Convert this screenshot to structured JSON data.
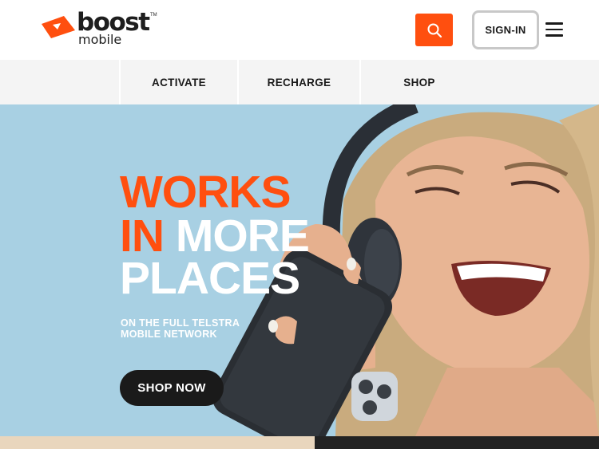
{
  "header": {
    "logo_word": "boost",
    "logo_sub": "mobile",
    "logo_tm": "TM",
    "search_icon": "search-icon",
    "signin_label": "SIGN-IN",
    "menu_icon": "hamburger-menu-icon"
  },
  "nav": {
    "items": [
      {
        "label": "ACTIVATE"
      },
      {
        "label": "RECHARGE"
      },
      {
        "label": "SHOP"
      }
    ]
  },
  "hero": {
    "line1": "WORKS",
    "line2_a": "IN",
    "line2_b": "MORE",
    "line3": "PLACES",
    "subline_1": "ON THE FULL TELSTRA",
    "subline_2": "MOBILE NETWORK",
    "cta_label": "SHOP NOW"
  },
  "colors": {
    "accent": "#ff4f0f",
    "dark": "#1a1a1a",
    "hero_bg": "#a8d0e3",
    "nav_bg": "#f4f4f4"
  }
}
